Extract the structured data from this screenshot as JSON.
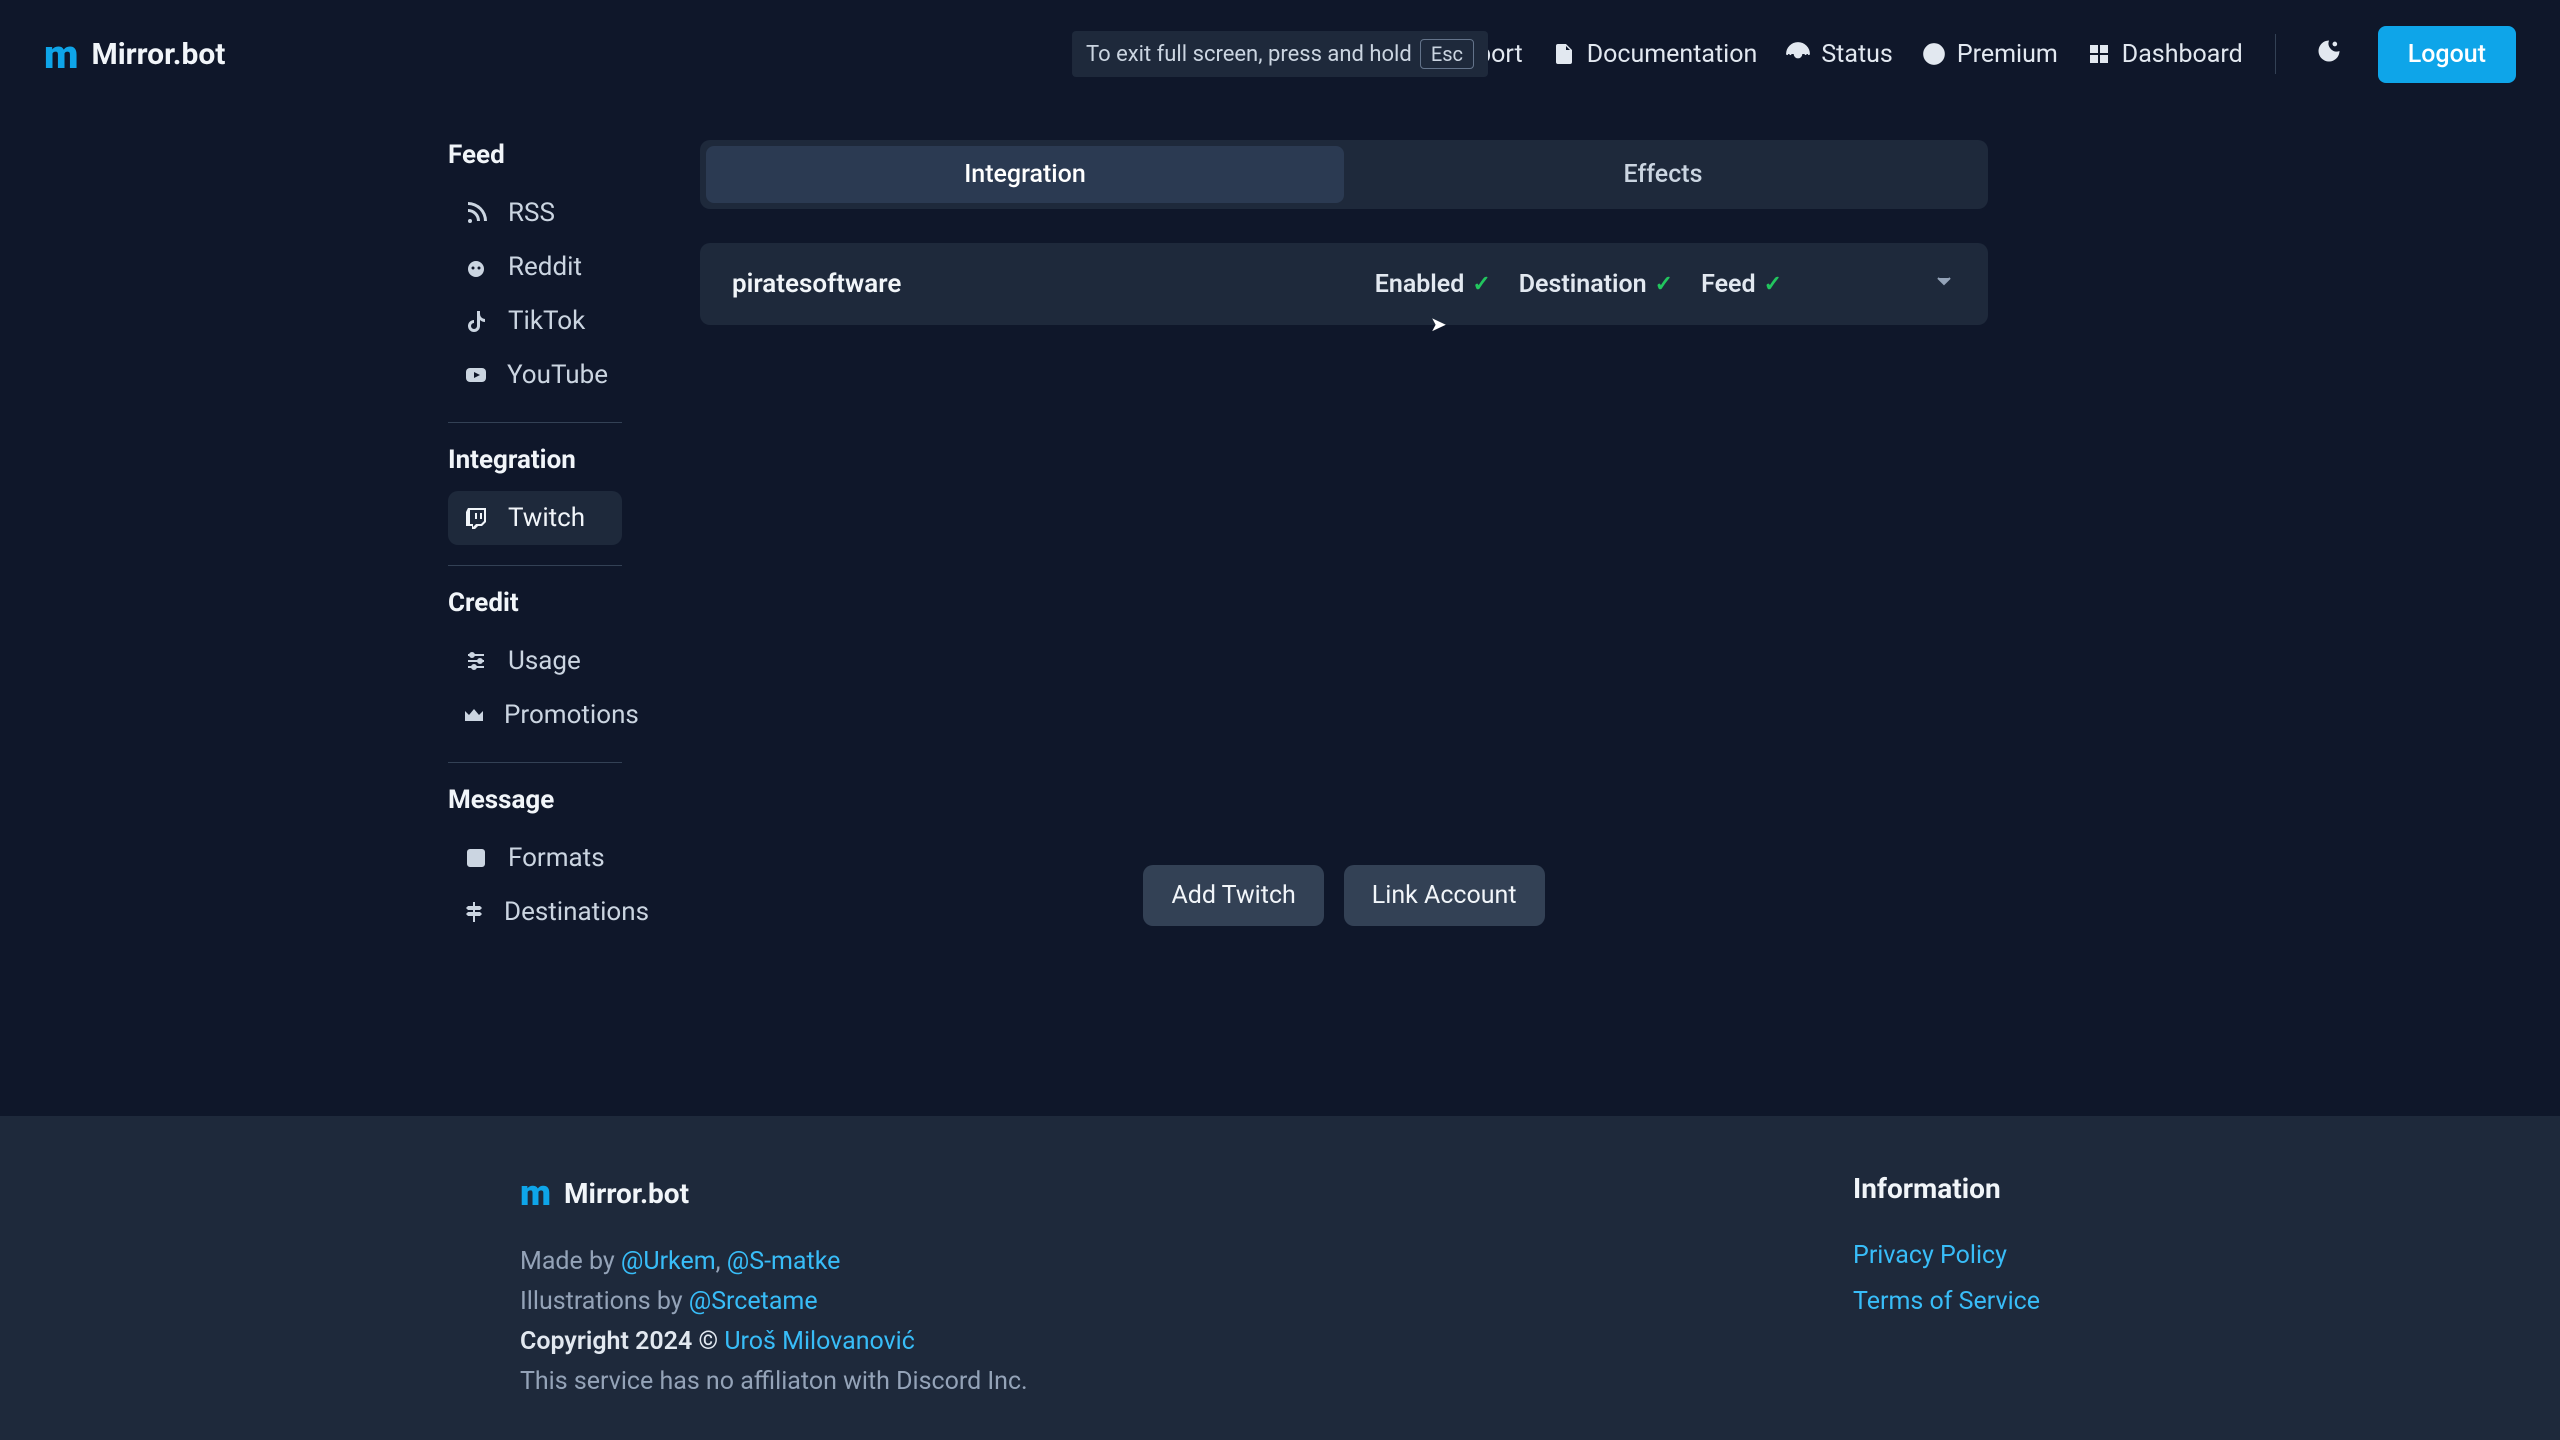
{
  "brand": "Mirror.bot",
  "fullscreen_hint": {
    "text": "To exit full screen, press and hold",
    "key": "Esc"
  },
  "nav": {
    "support": "Support",
    "documentation": "Documentation",
    "status": "Status",
    "premium": "Premium",
    "dashboard": "Dashboard",
    "logout": "Logout"
  },
  "sidebar": {
    "feed": {
      "heading": "Feed",
      "items": [
        "RSS",
        "Reddit",
        "TikTok",
        "YouTube"
      ]
    },
    "integration": {
      "heading": "Integration",
      "items": [
        "Twitch"
      ]
    },
    "credit": {
      "heading": "Credit",
      "items": [
        "Usage",
        "Promotions"
      ]
    },
    "message": {
      "heading": "Message",
      "items": [
        "Formats",
        "Destinations"
      ]
    }
  },
  "tabs": {
    "integration": "Integration",
    "effects": "Effects"
  },
  "row": {
    "name": "piratesoftware",
    "enabled_label": "Enabled",
    "destination_label": "Destination",
    "feed_label": "Feed"
  },
  "actions": {
    "add": "Add Twitch",
    "link": "Link Account"
  },
  "footer": {
    "made_by_prefix": "Made by ",
    "made_by_1": "@Urkem",
    "made_by_sep": ", ",
    "made_by_2": "@S-matke",
    "illustrations_prefix": "Illustrations by ",
    "illustrations_by": "@Srcetame",
    "copyright_prefix": "Copyright 2024 © ",
    "copyright_name": "Uroš Milovanović",
    "disclaimer": "This service has no affiliaton with Discord Inc.",
    "info_heading": "Information",
    "privacy": "Privacy Policy",
    "terms": "Terms of Service"
  }
}
